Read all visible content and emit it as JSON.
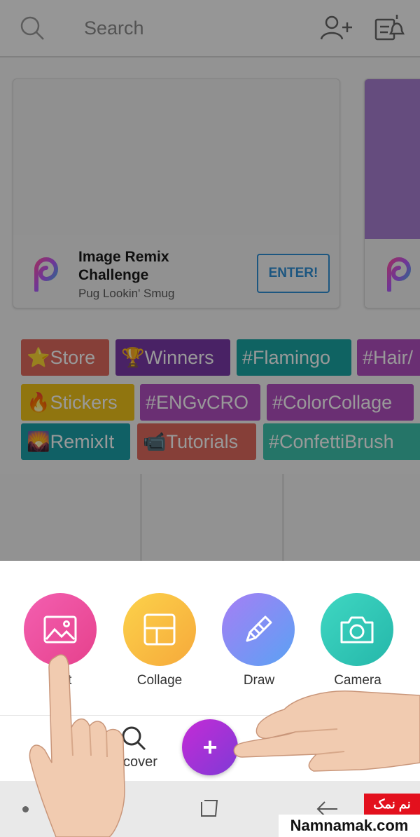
{
  "search": {
    "placeholder": "Search"
  },
  "icons": {
    "search": "search-icon",
    "add_user": "add-user-icon",
    "notifications": "notification-icon",
    "picsart_logo": "picsart-logo-icon",
    "edit": "image-icon",
    "collage": "collage-grid-icon",
    "draw": "pencil-icon",
    "camera": "camera-icon",
    "discover": "search-icon",
    "profile": "profile-icon"
  },
  "challenge_card": {
    "title": "Image Remix Challenge",
    "subtitle": "Pug Lookin' Smug",
    "button": "ENTER!"
  },
  "tags": [
    {
      "label": "⭐Store",
      "color": "#e06a5e"
    },
    {
      "label": "🏆Winners",
      "color": "#7b3aa8"
    },
    {
      "label": "#Flamingo",
      "color": "#1aa6a3"
    },
    {
      "label": "#Hair/",
      "color": "#b14fc0"
    },
    {
      "label": "🔥Stickers",
      "color": "#f0c419"
    },
    {
      "label": "#ENGvCRO",
      "color": "#b14fc0"
    },
    {
      "label": "#ColorCollage",
      "color": "#b14fc0"
    },
    {
      "label": "🌄RemixIt",
      "color": "#1ba0a8"
    },
    {
      "label": "📹Tutorials",
      "color": "#e06a5e"
    },
    {
      "label": "#ConfettiBrush",
      "color": "#3fc4ad"
    }
  ],
  "actions": [
    {
      "label": "Edit",
      "gradient": [
        "#f35fb0",
        "#e6418c"
      ]
    },
    {
      "label": "Collage",
      "gradient": [
        "#fcd24a",
        "#f6a93b"
      ]
    },
    {
      "label": "Draw",
      "gradient": [
        "#a67ef5",
        "#5aa2f3"
      ]
    },
    {
      "label": "Camera",
      "gradient": [
        "#3fd7c2",
        "#25b7aa"
      ]
    }
  ],
  "nav": {
    "discover_label": "scover",
    "fab_label": "+"
  },
  "watermark": {
    "persian": "نم نمک",
    "site": "Namnamak.com"
  }
}
